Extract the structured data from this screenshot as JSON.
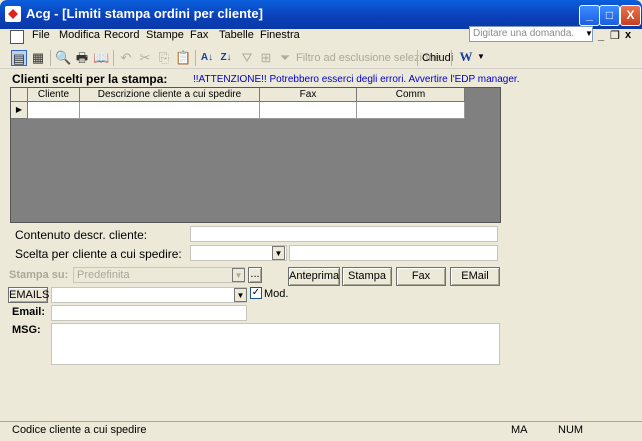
{
  "window": {
    "title": "Acg - [Limiti stampa ordini per cliente]",
    "minimize": "_",
    "maximize": "□",
    "close": "X"
  },
  "menu": [
    "File",
    "Modifica",
    "Record",
    "Stampe",
    "Fax",
    "Tabelle",
    "Finestra"
  ],
  "ask_placeholder": "Digitare una domanda.",
  "toolbar": {
    "filter_label": "Filtro ad esclusione selezione",
    "close_label": "Chiudi"
  },
  "header": {
    "section_title": "Clienti scelti per la stampa:",
    "warning": "!!ATTENZIONE!! Potrebbero esserci degli errori. Avvertire l'EDP manager."
  },
  "grid": {
    "columns": [
      "Cliente",
      "Descrizione cliente a cui spedire",
      "Fax",
      "Comm"
    ],
    "row_marker": "▶"
  },
  "form": {
    "contenuto_label": "Contenuto descr. cliente:",
    "scelta_label": "Scelta per cliente a cui spedire:",
    "stampa_su_label": "Stampa su:",
    "stampa_su_value": "Predefinita",
    "ellipsis": "...",
    "emails_button": "EMAILS",
    "mod_label": "Mod.",
    "email_label": "Email:",
    "msg_label": "MSG:"
  },
  "buttons": {
    "anteprima": "Anteprima",
    "stampa": "Stampa",
    "fax": "Fax",
    "email": "EMail"
  },
  "status": {
    "text": "Codice cliente a cui spedire",
    "ma": "MA",
    "num": "NUM"
  }
}
